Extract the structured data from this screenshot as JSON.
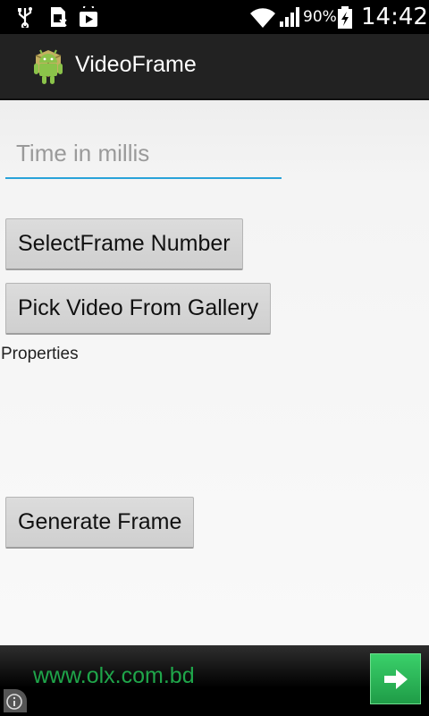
{
  "status_bar": {
    "battery_percent": "90%",
    "time": "14:42",
    "icons": [
      "usb-icon",
      "sim-icon",
      "play-store-icon",
      "wifi-icon",
      "signal-icon",
      "battery-charging-icon"
    ]
  },
  "action_bar": {
    "title": "VideoFrame",
    "logo_icon": "android-logo-icon"
  },
  "form": {
    "time_placeholder": "Time in millis",
    "time_value": "",
    "select_frame_label": "SelectFrame Number",
    "pick_video_label": "Pick Video From Gallery",
    "properties_label": "Properties",
    "generate_label": "Generate Frame"
  },
  "ad": {
    "text": "www.olx.com.bd",
    "arrow_icon": "arrow-right-icon",
    "info_icon": "info-icon",
    "accent_color": "#1fa64a"
  }
}
